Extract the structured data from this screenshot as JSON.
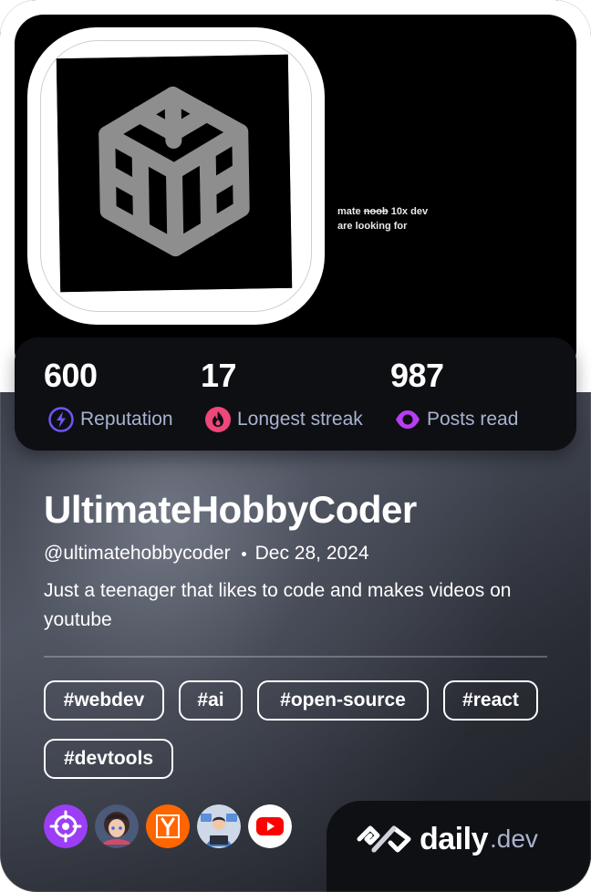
{
  "cover": {
    "text_part1": "mate ",
    "text_strike": "noob",
    "text_part2": " 10x dev",
    "text_line2": "are looking for"
  },
  "avatar": {
    "icon": "codepen-cube-icon"
  },
  "stats": [
    {
      "value": "600",
      "label": "Reputation",
      "icon": "lightning-icon",
      "color": "#6e56f6"
    },
    {
      "value": "17",
      "label": "Longest streak",
      "icon": "flame-icon",
      "color": "#f0467a"
    },
    {
      "value": "987",
      "label": "Posts read",
      "icon": "eye-ring-icon",
      "color": "#b73ef2"
    }
  ],
  "profile": {
    "name": "UltimateHobbyCoder",
    "handle": "@ultimatehobbycoder",
    "joined": "Dec 28, 2024",
    "bio": "Just a teenager that likes to code and makes videos on youtube"
  },
  "tags": [
    "#webdev",
    "#ai",
    "#open-source",
    "#react",
    "#devtools"
  ],
  "sources": [
    {
      "name": "crosshair-source-icon",
      "color": "#9b3ef5"
    },
    {
      "name": "anime-avatar-source-icon",
      "color": "#5a6a8a"
    },
    {
      "name": "hacker-news-source-icon",
      "color": "#ff6600"
    },
    {
      "name": "developer-avatar-source-icon",
      "color": "#cfd8e8"
    },
    {
      "name": "youtube-source-icon",
      "color": "#ff0000"
    }
  ],
  "brand": {
    "word": "daily",
    "suffix": ".dev"
  }
}
